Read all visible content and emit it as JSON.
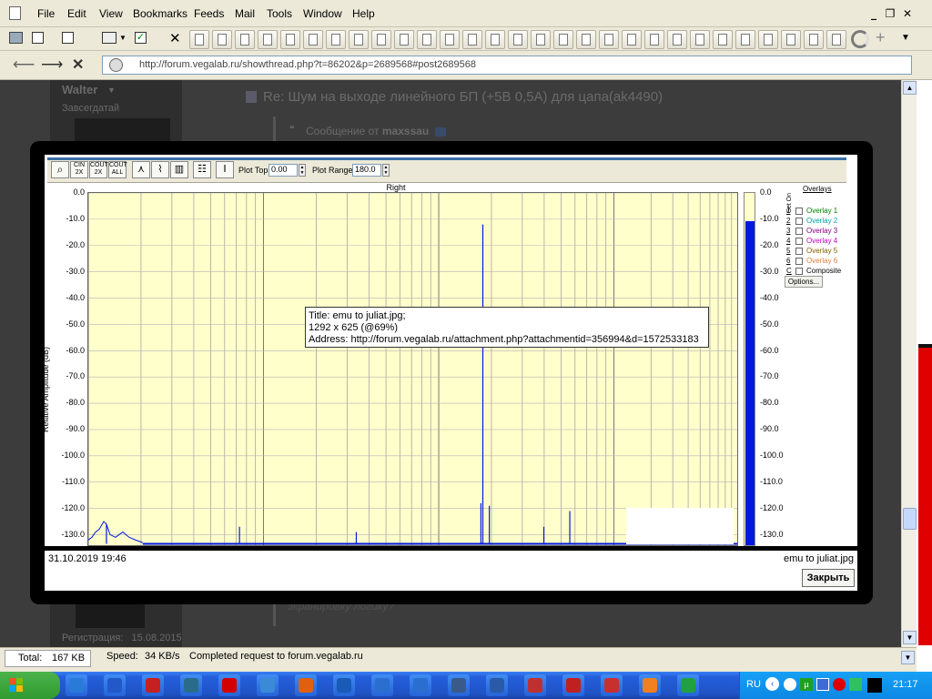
{
  "menu": [
    "File",
    "Edit",
    "View",
    "Bookmarks",
    "Feeds",
    "Mail",
    "Tools",
    "Window",
    "Help"
  ],
  "window_controls": {
    "minimize": "_",
    "restore": "❐",
    "close": "✕"
  },
  "address": {
    "url": "http://forum.vegalab.ru/showthread.php?t=86202&p=2689568#post2689568"
  },
  "forum": {
    "username": "Walter",
    "user_title": "Завсегдатай",
    "post_title": "Re: Шум на выходе линейного БП (+5В 0,5А) для цапа(ak4490)",
    "quote_prefix": "Сообщение от",
    "quote_author": "maxssau",
    "registration_label": "Регистрация:",
    "registration_date": "15.08.2015",
    "bottom_text": "экранировку логику?"
  },
  "lightbox": {
    "date": "31.10.2019 19:46",
    "filename": "emu to juliat.jpg",
    "close_label": "Закрыть",
    "tooltip": {
      "title": "Title: emu to juliat.jpg;",
      "size": "1292 x 625 (@69%)",
      "address": "Address: http://forum.vegalab.ru/attachment.php?attachmentid=356994&d=1572533183"
    }
  },
  "analyzer": {
    "plot_top_label": "Plot Top:",
    "plot_top_value": "0.00",
    "plot_range_label": "Plot Range:",
    "plot_range_value": "180.0",
    "channel": "Right",
    "ylabel": "Relative Amplitude (dB)",
    "overlays_title": "Overlays",
    "set_label": "Set",
    "on_label": "On",
    "overlays": [
      {
        "key": "1",
        "name": "Overlay 1",
        "color": "#008000"
      },
      {
        "key": "2",
        "name": "Overlay 2",
        "color": "#00a0a0"
      },
      {
        "key": "3",
        "name": "Overlay 3",
        "color": "#800080"
      },
      {
        "key": "4",
        "name": "Overlay 4",
        "color": "#c000c0"
      },
      {
        "key": "5",
        "name": "Overlay 5",
        "color": "#806000"
      },
      {
        "key": "6",
        "name": "Overlay 6",
        "color": "#e08040"
      },
      {
        "key": "C",
        "name": "Composite",
        "color": "#000000"
      }
    ],
    "options_label": "Options...",
    "y_ticks": [
      "0.0",
      "-10.0",
      "-20.0",
      "-30.0",
      "-40.0",
      "-50.0",
      "-60.0",
      "-70.0",
      "-80.0",
      "-90.0",
      "-100.0",
      "-110.0",
      "-120.0",
      "-130.0"
    ],
    "meter_ticks": [
      "0.0",
      "-10.0",
      "-20.0",
      "-30.0",
      "-40.0",
      "-50.0",
      "-60.0",
      "-70.0",
      "-80.0",
      "-90.0",
      "-100.0",
      "-110.0",
      "-120.0",
      "-130.0"
    ]
  },
  "chart_data": {
    "type": "line",
    "ylabel": "Relative Amplitude (dB)",
    "ylim": [
      -134,
      0
    ],
    "xscale": "log",
    "series": [
      {
        "name": "Right",
        "peaks": [
          {
            "x": 0.608,
            "y": -12
          },
          {
            "x": 0.605,
            "y": -118
          },
          {
            "x": 0.618,
            "y": -119
          },
          {
            "x": 0.233,
            "y": -127
          },
          {
            "x": 0.413,
            "y": -129
          },
          {
            "x": 0.702,
            "y": -127
          },
          {
            "x": 0.742,
            "y": -121
          },
          {
            "x": 0.028,
            "y": -126
          }
        ]
      }
    ],
    "grid": true
  },
  "status": {
    "total_label": "Total:",
    "total_value": "167 KB",
    "speed_label": "Speed:",
    "speed_value": "34 KB/s",
    "message": "Completed request to forum.vegalab.ru"
  },
  "taskbar": {
    "lang": "RU",
    "clock": "21:17"
  }
}
